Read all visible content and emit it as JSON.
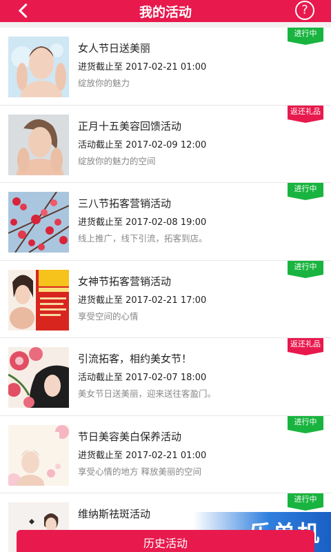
{
  "header": {
    "title": "我的活动",
    "help_label": "?"
  },
  "activities": [
    {
      "title": "女人节日送美丽",
      "date": "进货截止至 2017-02-21 01:00",
      "desc": "绽放你的魅力",
      "status": "进行中",
      "status_color": "#19b43f"
    },
    {
      "title": "正月十五美容回馈活动",
      "date": "活动截止至 2017-02-09 12:00",
      "desc": "绽放你的魅力的空间",
      "status": "返还礼品",
      "status_color": "#e8194d"
    },
    {
      "title": "三八节拓客营销活动",
      "date": "进货截止至 2017-02-08 19:00",
      "desc": "线上推广，线下引流，拓客到店。",
      "status": "进行中",
      "status_color": "#19b43f"
    },
    {
      "title": "女神节拓客营销活动",
      "date": "进货截止至 2017-02-21 17:00",
      "desc": "享受空间的心情",
      "status": "进行中",
      "status_color": "#19b43f"
    },
    {
      "title": "引流拓客，相约美女节！",
      "date": "活动截止至 2017-02-07 18:00",
      "desc": "美女节日送美丽，迎来送往客盈门。",
      "status": "返还礼品",
      "status_color": "#e8194d"
    },
    {
      "title": "节日美容美白保养活动",
      "date": "进货截止至 2017-02-21 01:00",
      "desc": "享受心情的地方 释放美丽的空间",
      "status": "进行中",
      "status_color": "#19b43f"
    },
    {
      "title": "维纳斯祛斑活动",
      "status": "进行中",
      "status_color": "#19b43f"
    }
  ],
  "bottom_button": "历史活动",
  "watermark": "乐单机",
  "colors": {
    "brand": "#e8194d",
    "active": "#19b43f"
  }
}
